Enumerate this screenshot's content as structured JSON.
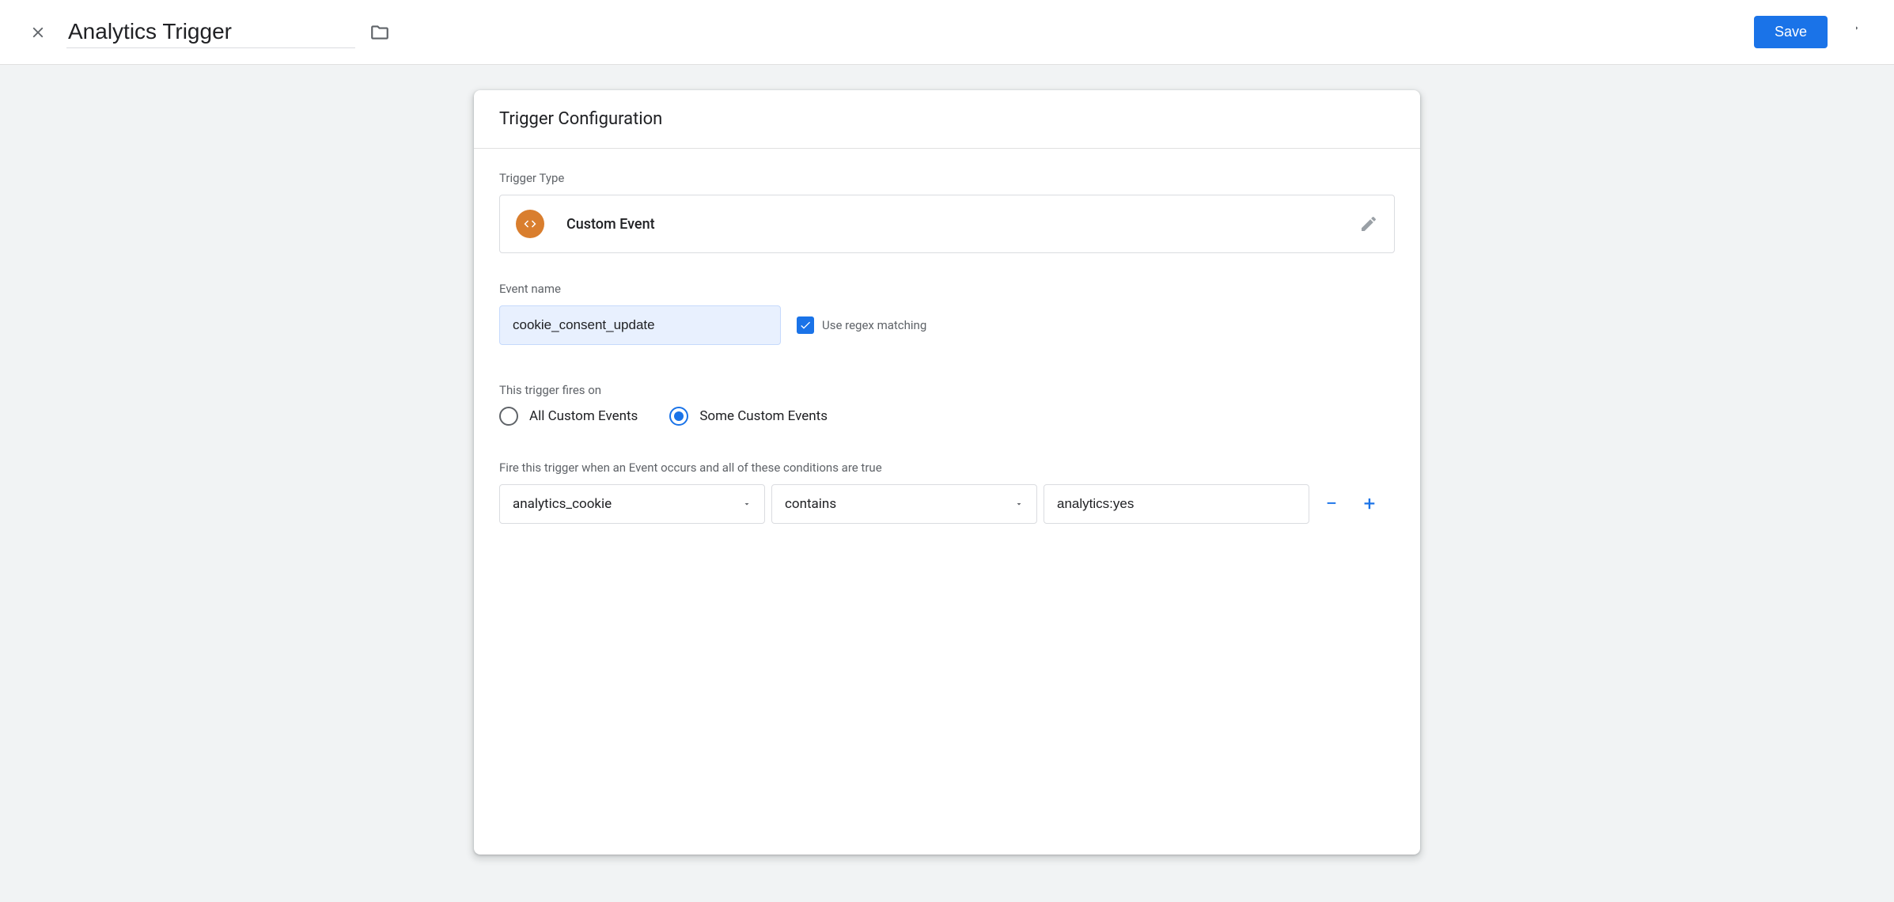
{
  "header": {
    "title": "Analytics Trigger",
    "save_label": "Save"
  },
  "card": {
    "title": "Trigger Configuration",
    "trigger_type_label": "Trigger Type",
    "trigger_type_name": "Custom Event",
    "event_name_label": "Event name",
    "event_name_value": "cookie_consent_update",
    "regex_checkbox_label": "Use regex matching",
    "regex_checked": true,
    "fires_on_label": "This trigger fires on",
    "radio_all_label": "All Custom Events",
    "radio_some_label": "Some Custom Events",
    "radio_selected": "some",
    "conditions_label": "Fire this trigger when an Event occurs and all of these conditions are true",
    "condition": {
      "variable": "analytics_cookie",
      "operator": "contains",
      "value": "analytics:yes"
    }
  },
  "icons": {
    "close": "close-icon",
    "folder": "folder-icon",
    "more": "more-vert-icon",
    "code": "code-icon",
    "pencil": "pencil-icon",
    "check": "check-icon",
    "dropdown": "dropdown-icon",
    "minus": "−",
    "plus": "+"
  },
  "colors": {
    "primary": "#1a73e8",
    "type_icon_bg": "#d97e2e",
    "input_bg": "#e8f0fe"
  }
}
